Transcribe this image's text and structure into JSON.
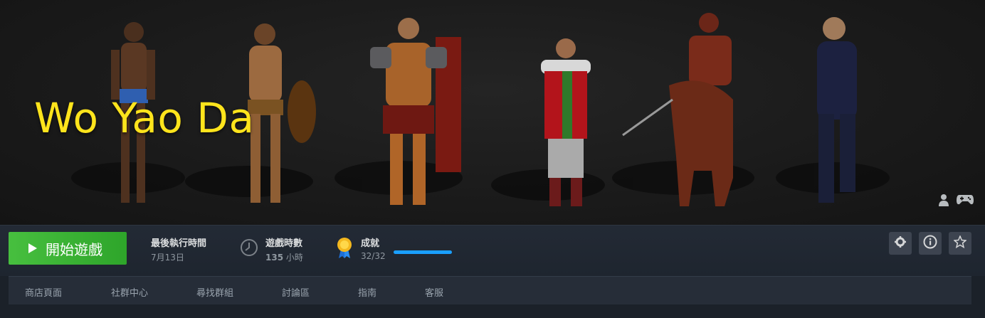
{
  "hero": {
    "title": "Wo Yao Da",
    "icons": [
      "person-icon",
      "controller-icon"
    ]
  },
  "bar": {
    "play_label": "開始遊戲",
    "last_played": {
      "title": "最後執行時間",
      "value": "7月13日"
    },
    "playtime": {
      "title": "遊戲時數",
      "value_num": "135",
      "value_unit": "小時",
      "icon": "clock-icon"
    },
    "achievements": {
      "title": "成就",
      "value": "32/32",
      "icon": "medal-icon",
      "progress": 1.0
    },
    "right_buttons": [
      "gear-icon",
      "info-icon",
      "star-icon"
    ]
  },
  "nav": {
    "items": [
      {
        "label": "商店頁面"
      },
      {
        "label": "社群中心"
      },
      {
        "label": "尋找群組"
      },
      {
        "label": "討論區"
      },
      {
        "label": "指南"
      },
      {
        "label": "客服"
      }
    ]
  },
  "colors": {
    "title_yellow": "#ffe41c",
    "play_green": "#47bf3f",
    "progress_blue": "#1a9fff",
    "background": "#1b2129"
  }
}
